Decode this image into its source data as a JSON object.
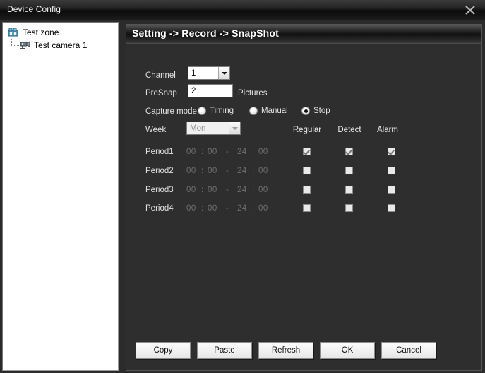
{
  "window": {
    "title": "Device Config",
    "close_icon": "close-icon"
  },
  "sidebar": {
    "nodes": [
      {
        "label": "Test zone",
        "icon": "zone-icon",
        "level": 0
      },
      {
        "label": "Test camera 1",
        "icon": "camera-icon",
        "level": 1
      }
    ]
  },
  "panel": {
    "header": "Setting -> Record -> SnapShot"
  },
  "form": {
    "channel_label": "Channel",
    "channel_value": "1",
    "presnap_label": "PreSnap",
    "presnap_value": "2",
    "presnap_unit": "Pictures",
    "capture_mode_label": "Capture mode",
    "capture_modes": [
      {
        "label": "Timing",
        "selected": false
      },
      {
        "label": "Manual",
        "selected": false
      },
      {
        "label": "Stop",
        "selected": true
      }
    ],
    "week_label": "Week",
    "week_value": "Mon",
    "columns": [
      "Regular",
      "Detect",
      "Alarm"
    ],
    "periods": [
      {
        "label": "Period1",
        "start_hour": "00",
        "start_min": "00",
        "end_hour": "24",
        "end_min": "00",
        "separator": "-",
        "regular": true,
        "detect": true,
        "alarm": true
      },
      {
        "label": "Period2",
        "start_hour": "00",
        "start_min": "00",
        "end_hour": "24",
        "end_min": "00",
        "separator": "-",
        "regular": false,
        "detect": false,
        "alarm": false
      },
      {
        "label": "Period3",
        "start_hour": "00",
        "start_min": "00",
        "end_hour": "24",
        "end_min": "00",
        "separator": "-",
        "regular": false,
        "detect": false,
        "alarm": false
      },
      {
        "label": "Period4",
        "start_hour": "00",
        "start_min": "00",
        "end_hour": "24",
        "end_min": "00",
        "separator": "-",
        "regular": false,
        "detect": false,
        "alarm": false
      }
    ]
  },
  "buttons": [
    {
      "label": "Copy"
    },
    {
      "label": "Paste"
    },
    {
      "label": "Refresh"
    },
    {
      "label": "OK"
    },
    {
      "label": "Cancel"
    }
  ]
}
